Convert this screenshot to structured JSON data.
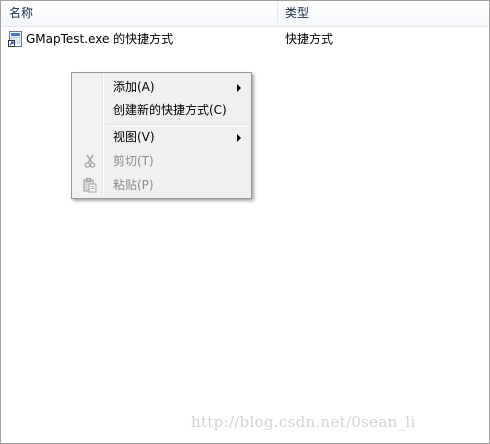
{
  "header": {
    "col_name": "名称",
    "col_type": "类型"
  },
  "files": [
    {
      "name": "GMapTest.exe 的快捷方式",
      "type": "快捷方式",
      "icon": "shortcut-file-icon"
    }
  ],
  "context_menu": {
    "items": [
      {
        "label": "添加(A)",
        "has_submenu": true,
        "enabled": true
      },
      {
        "label": "创建新的快捷方式(C)",
        "has_submenu": false,
        "enabled": true
      },
      {
        "label": "视图(V)",
        "has_submenu": true,
        "enabled": true
      },
      {
        "label": "剪切(T)",
        "has_submenu": false,
        "enabled": false,
        "icon": "scissors-icon"
      },
      {
        "label": "粘贴(P)",
        "has_submenu": false,
        "enabled": false,
        "icon": "paste-icon"
      }
    ]
  },
  "watermark": "http://blog.csdn.net/0sean_li",
  "colors": {
    "menu_bg": "#f0f0f0",
    "disabled_text": "#8d8d8d",
    "header_text": "#1e2d4a"
  }
}
